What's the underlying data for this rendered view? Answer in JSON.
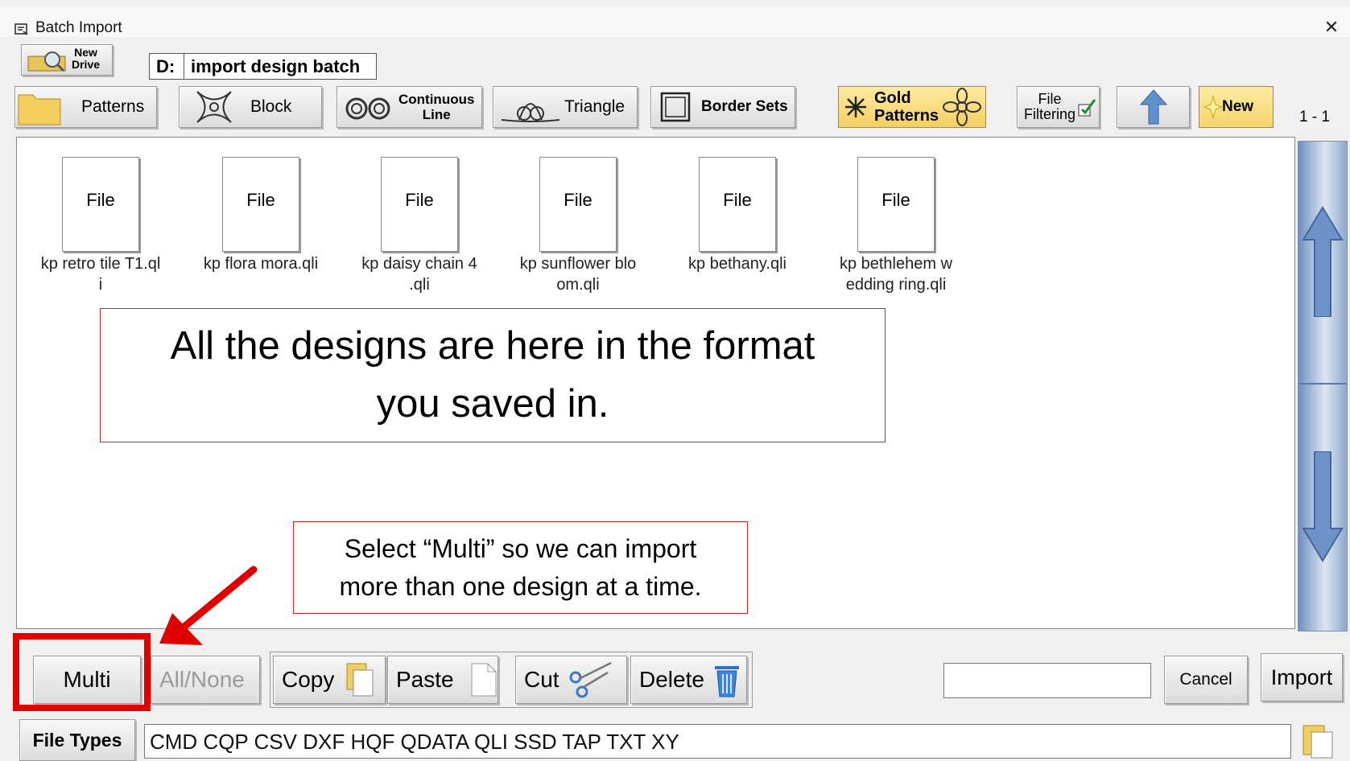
{
  "window": {
    "title": "Batch Import",
    "close": "✕"
  },
  "drive": {
    "new_drive_label": "New Drive",
    "new_drive_line1": "New",
    "new_drive_line2": "Drive",
    "letter": "D:",
    "path": "import design batch"
  },
  "toolbar": {
    "patterns": "Patterns",
    "block": "Block",
    "continuous_line_1": "Continuous",
    "continuous_line_2": "Line",
    "triangle": "Triangle",
    "border_sets": "Border Sets",
    "gold_1": "Gold",
    "gold_2": "Patterns",
    "file_filtering_1": "File",
    "file_filtering_2": "Filtering",
    "new": "New",
    "page_count": "1 - 1"
  },
  "files": [
    {
      "icon_label": "File",
      "name_line1": "kp retro tile T1.ql",
      "name_line2": "i"
    },
    {
      "icon_label": "File",
      "name_line1": "kp flora mora.qli",
      "name_line2": ""
    },
    {
      "icon_label": "File",
      "name_line1": "kp daisy chain 4",
      "name_line2": ".qli"
    },
    {
      "icon_label": "File",
      "name_line1": "kp sunflower blo",
      "name_line2": "om.qli"
    },
    {
      "icon_label": "File",
      "name_line1": "kp bethany.qli",
      "name_line2": ""
    },
    {
      "icon_label": "File",
      "name_line1": "kp bethlehem w",
      "name_line2": "edding ring.qli"
    }
  ],
  "annotations": {
    "main_line1": "All the designs are here in the format",
    "main_line2": "you saved in.",
    "multi_line1": "Select “Multi” so we can import",
    "multi_line2": "more than one design at a time."
  },
  "bottom": {
    "multi": "Multi",
    "all_none": "All/None",
    "copy": "Copy",
    "paste": "Paste",
    "cut": "Cut",
    "delete": "Delete",
    "cancel": "Cancel",
    "import": "Import",
    "name_value": ""
  },
  "file_types": {
    "label": "File Types",
    "list": "CMD  CQP  CSV  DXF  HQF  QDATA  QLI  SSD  TAP  TXT  XY"
  },
  "colors": {
    "annotation_red": "#e02020",
    "gold": "#f3cf63",
    "scroll_blue": "#6f8fbf"
  }
}
